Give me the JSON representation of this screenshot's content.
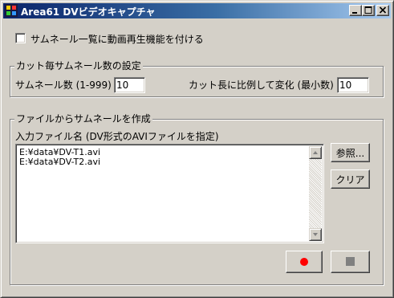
{
  "window": {
    "title": "Area61 DVビデオキャプチャ",
    "icon": "app-icon",
    "controls": {
      "minimize": "minimize-icon",
      "maximize": "maximize-icon",
      "close": "close-icon"
    }
  },
  "playback_option": {
    "label": "サムネール一覧に動画再生機能を付ける",
    "checked": false
  },
  "thumbnail_settings": {
    "title": "カット毎サムネール数の設定",
    "count_label": "サムネール数 (1-999)",
    "count_value": "10",
    "proportional_label": "カット長に比例して変化 (最小数)",
    "proportional_value": "10"
  },
  "file_section": {
    "title": "ファイルからサムネールを作成",
    "input_label": "入力ファイル名 (DV形式のAVIファイルを指定)",
    "files": [
      "E:¥data¥DV-T1.avi",
      "E:¥data¥DV-T2.avi"
    ],
    "browse_label": "参照...",
    "clear_label": "クリア"
  },
  "actions": {
    "record": {
      "icon": "record-icon",
      "color": "#ff0000"
    },
    "stop": {
      "icon": "stop-icon",
      "color": "#808080"
    }
  }
}
